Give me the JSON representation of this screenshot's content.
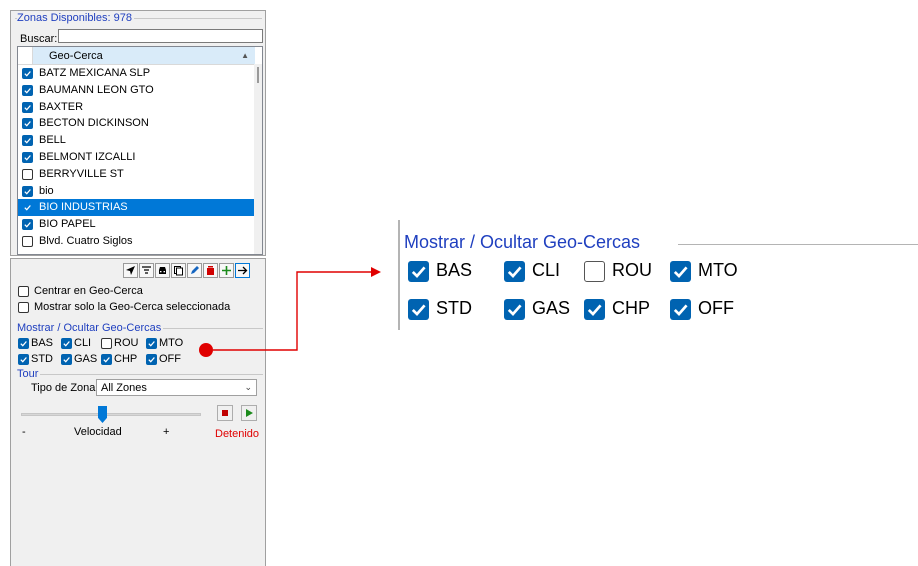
{
  "zones_panel": {
    "legend": "Zonas Disponibles: 978",
    "search_label": "Buscar:",
    "search_value": "",
    "column_header": "Geo-Cerca",
    "items": [
      {
        "label": "BATZ MEXICANA SLP",
        "checked": true,
        "selected": false
      },
      {
        "label": "BAUMANN LEON GTO",
        "checked": true,
        "selected": false
      },
      {
        "label": "BAXTER",
        "checked": true,
        "selected": false
      },
      {
        "label": "BECTON DICKINSON",
        "checked": true,
        "selected": false
      },
      {
        "label": "BELL",
        "checked": true,
        "selected": false
      },
      {
        "label": "BELMONT IZCALLI",
        "checked": true,
        "selected": false
      },
      {
        "label": "BERRYVILLE ST",
        "checked": false,
        "selected": false
      },
      {
        "label": "bio",
        "checked": true,
        "selected": false
      },
      {
        "label": "BIO INDUSTRIAS",
        "checked": true,
        "selected": true
      },
      {
        "label": "BIO PAPEL",
        "checked": true,
        "selected": false
      },
      {
        "label": "Blvd. Cuatro Siglos",
        "checked": false,
        "selected": false
      }
    ]
  },
  "toolbar": {
    "icons": [
      "navigate-icon",
      "filter-icon",
      "car-icon",
      "copy-icon",
      "edit-icon",
      "delete-icon",
      "add-icon",
      "forward-icon"
    ]
  },
  "options": {
    "center_label": "Centrar en Geo-Cerca",
    "center_checked": false,
    "only_selected_label": "Mostrar solo la Geo-Cerca seleccionada",
    "only_selected_checked": false
  },
  "geocercas": {
    "legend": "Mostrar / Ocultar Geo-Cercas",
    "items": [
      {
        "label": "BAS",
        "checked": true
      },
      {
        "label": "CLI",
        "checked": true
      },
      {
        "label": "ROU",
        "checked": false
      },
      {
        "label": "MTO",
        "checked": true
      },
      {
        "label": "STD",
        "checked": true
      },
      {
        "label": "GAS",
        "checked": true
      },
      {
        "label": "CHP",
        "checked": true
      },
      {
        "label": "OFF",
        "checked": true
      }
    ]
  },
  "tour": {
    "legend": "Tour",
    "zone_type_label": "Tipo de Zona:",
    "zone_type_value": "All Zones",
    "speed_min_label": "-",
    "speed_label": "Velocidad",
    "speed_max_label": "+",
    "speed_level_fraction": 0.45,
    "status": "Detenido"
  },
  "colors": {
    "accent": "#0063b1",
    "legend_blue": "#1f3fbf",
    "selection": "#0078d7",
    "status_red": "#e00000",
    "connector_red": "#e00000"
  }
}
